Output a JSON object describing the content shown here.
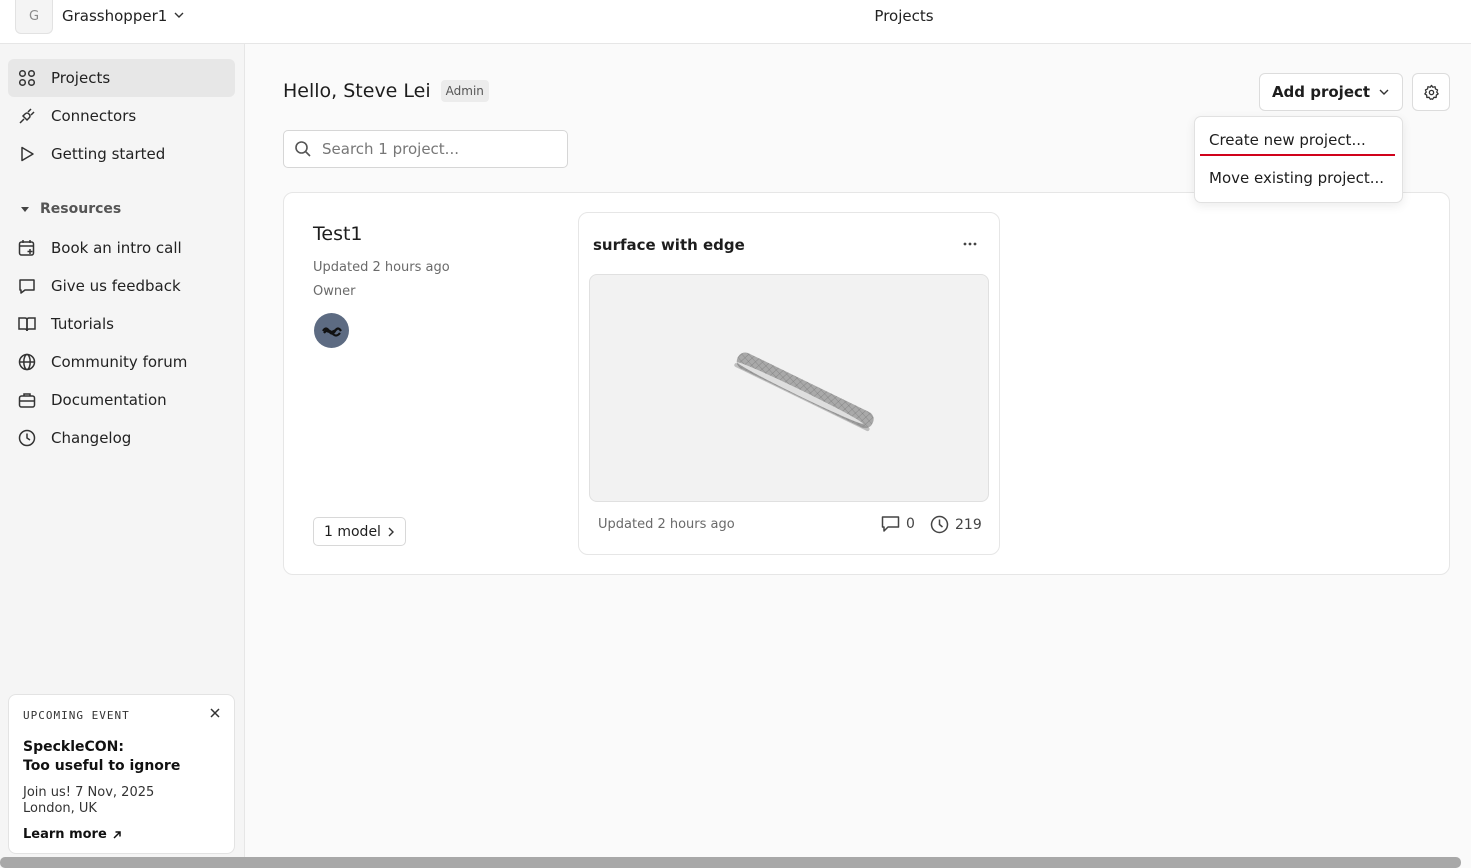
{
  "topbar": {
    "workspace_initial": "G",
    "workspace_name": "Grasshopper1",
    "page_title": "Projects"
  },
  "sidebar": {
    "main_items": [
      {
        "label": "Projects",
        "icon": "grid-icon",
        "active": true
      },
      {
        "label": "Connectors",
        "icon": "plug-icon"
      },
      {
        "label": "Getting started",
        "icon": "play-icon"
      }
    ],
    "resources_label": "Resources",
    "resource_items": [
      {
        "label": "Book an intro call",
        "icon": "calendar-plus-icon"
      },
      {
        "label": "Give us feedback",
        "icon": "message-icon"
      },
      {
        "label": "Tutorials",
        "icon": "book-icon"
      },
      {
        "label": "Community forum",
        "icon": "globe-icon"
      },
      {
        "label": "Documentation",
        "icon": "briefcase-icon"
      },
      {
        "label": "Changelog",
        "icon": "clock-icon"
      }
    ],
    "event": {
      "kicker": "UPCOMING EVENT",
      "title_line1": "SpeckleCON:",
      "title_line2": "Too useful to ignore",
      "desc_line1": "Join us! 7 Nov, 2025",
      "desc_line2": "London, UK",
      "link": "Learn more"
    }
  },
  "main": {
    "greeting": "Hello, Steve Lei",
    "role_badge": "Admin",
    "add_project_label": "Add project",
    "search_placeholder": "Search 1 project...",
    "dropdown": {
      "create": "Create new project...",
      "move": "Move existing project..."
    },
    "project": {
      "name": "Test1",
      "updated": "Updated 2 hours ago",
      "role": "Owner",
      "models_button": "1 model"
    },
    "model": {
      "name": "surface with edge",
      "updated": "Updated 2 hours ago",
      "comments": "0",
      "versions": "219"
    }
  },
  "colors": {
    "accent_underline": "#d0021b",
    "sidebar_active": "#e7e7e7",
    "avatar": "#5d6b82"
  }
}
